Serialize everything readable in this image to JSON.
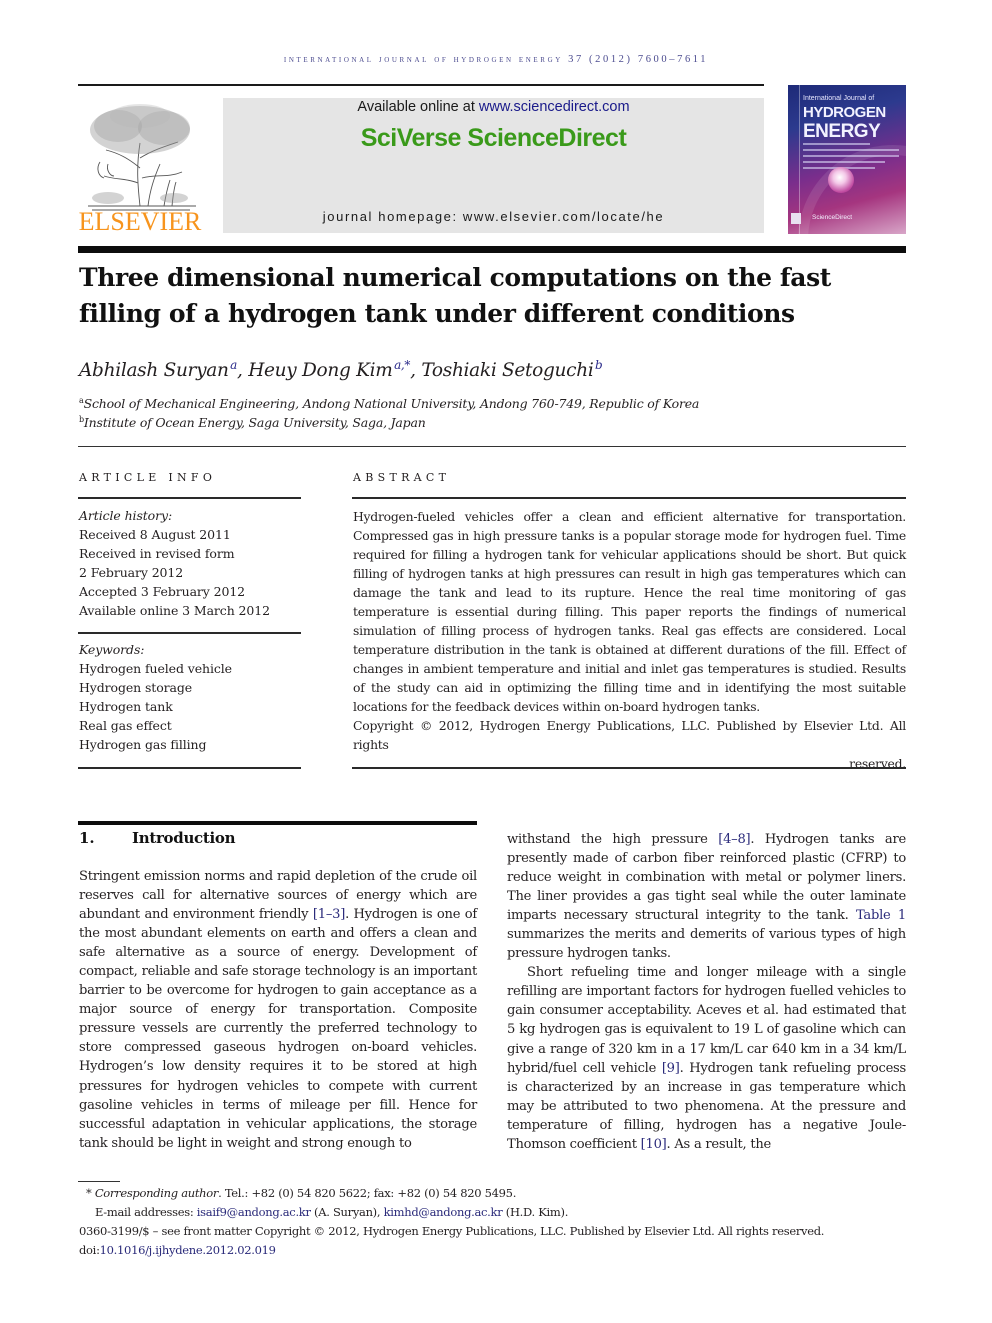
{
  "running_head": "international journal of hydrogen energy 37 (2012) 7600–7611",
  "publisher": {
    "logo_word": "ELSEVIER",
    "available_prefix": "Available online at ",
    "available_link": "www.sciencedirect.com",
    "brand": "SciVerse ScienceDirect",
    "homepage_label": "journal homepage: ",
    "homepage_url": "www.elsevier.com/locate/he"
  },
  "cover": {
    "line1": "International Journal of",
    "line2": "HYDROGEN",
    "line3": "ENERGY",
    "footer": "ScienceDirect"
  },
  "article": {
    "title": "Three dimensional numerical computations on the fast filling of a hydrogen tank under different conditions",
    "authors": [
      {
        "name": "Abhilash Suryan",
        "sup": "a"
      },
      {
        "name": "Heuy Dong Kim",
        "sup": "a,*"
      },
      {
        "name": "Toshiaki Setoguchi",
        "sup": "b"
      }
    ],
    "affiliations": [
      {
        "mark": "a",
        "text": "School of Mechanical Engineering, Andong National University, Andong 760-749, Republic of Korea"
      },
      {
        "mark": "b",
        "text": "Institute of Ocean Energy, Saga University, Saga, Japan"
      }
    ]
  },
  "article_info": {
    "heading": "ARTICLE INFO",
    "history_label": "Article history:",
    "history": [
      "Received 8 August 2011",
      "Received in revised form",
      "2 February 2012",
      "Accepted 3 February 2012",
      "Available online 3 March 2012"
    ],
    "keywords_label": "Keywords:",
    "keywords": [
      "Hydrogen fueled vehicle",
      "Hydrogen storage",
      "Hydrogen tank",
      "Real gas effect",
      "Hydrogen gas filling"
    ]
  },
  "abstract": {
    "heading": "ABSTRACT",
    "text": "Hydrogen-fueled vehicles offer a clean and efficient alternative for transportation. Compressed gas in high pressure tanks is a popular storage mode for hydrogen fuel. Time required for filling a hydrogen tank for vehicular applications should be short. But quick filling of hydrogen tanks at high pressures can result in high gas temperatures which can damage the tank and lead to its rupture. Hence the real time monitoring of gas temperature is essential during filling. This paper reports the findings of numerical simulation of filling process of hydrogen tanks. Real gas effects are considered. Local temperature distribution in the tank is obtained at different durations of the fill. Effect of changes in ambient temperature and initial and inlet gas temperatures is studied. Results of the study can aid in optimizing the filling time and in identifying the most suitable locations for the feedback devices within on-board hydrogen tanks.",
    "copyright_line1": "Copyright © 2012, Hydrogen Energy Publications, LLC. Published by Elsevier Ltd. All rights",
    "copyright_line2": "reserved."
  },
  "introduction": {
    "number": "1.",
    "title": "Introduction",
    "left_p1_a": "Stringent emission norms and rapid depletion of the crude oil reserves call for alternative sources of energy which are abundant and environment friendly ",
    "left_ref1": "[1–3]",
    "left_p1_b": ". Hydrogen is one of the most abundant elements on earth and offers a clean and safe alternative as a source of energy. Development of compact, reliable and safe storage technology is an important barrier to be overcome for hydrogen to gain acceptance as a major source of energy for transportation. Composite pressure vessels are currently the preferred technology to store compressed gaseous hydrogen on-board vehicles. Hydrogen’s low density requires it to be stored at high pressures for hydrogen vehicles to compete with current gasoline vehicles in terms of mileage per fill. Hence for successful adaptation in vehicular applications, the storage tank should be light in weight and strong enough to",
    "right_p1_a": "withstand the high pressure ",
    "right_ref1": "[4–8]",
    "right_p1_b": ". Hydrogen tanks are presently made of carbon fiber reinforced plastic (CFRP) to reduce weight in combination with metal or polymer liners. The liner provides a gas tight seal while the outer laminate imparts necessary structural integrity to the tank. ",
    "right_ref_table": "Table 1",
    "right_p1_c": " summarizes the merits and demerits of various types of high pressure hydrogen tanks.",
    "right_p2_a": "Short refueling time and longer mileage with a single refilling are important factors for hydrogen fuelled vehicles to gain consumer acceptability. Aceves et al. had estimated that 5 kg hydrogen gas is equivalent to 19 L of gasoline which can give a range of 320 km in a 17 km/L car 640 km in a 34 km/L hybrid/fuel cell vehicle ",
    "right_ref2": "[9]",
    "right_p2_b": ". Hydrogen tank refueling process is characterized by an increase in gas temperature which may be attributed to two phenomena. At the pressure and temperature of filling, hydrogen has a negative Joule-Thomson coefficient ",
    "right_ref3": "[10]",
    "right_p2_c": ". As a result, the"
  },
  "footnotes": {
    "corr_mark": "*",
    "corr_label": "Corresponding author",
    "corr_text": ". Tel.: +82 (0) 54 820 5622; fax: +82 (0) 54 820 5495.",
    "email_label": "E-mail addresses: ",
    "email1": "isaif9@andong.ac.kr",
    "email1_who": " (A. Suryan), ",
    "email2": "kimhd@andong.ac.kr",
    "email2_who": " (H.D. Kim).",
    "issn_line": "0360-3199/$ – see front matter Copyright © 2012, Hydrogen Energy Publications, LLC. Published by Elsevier Ltd. All rights reserved.",
    "doi_label": "doi:",
    "doi": "10.1016/j.ijhydene.2012.02.019"
  }
}
